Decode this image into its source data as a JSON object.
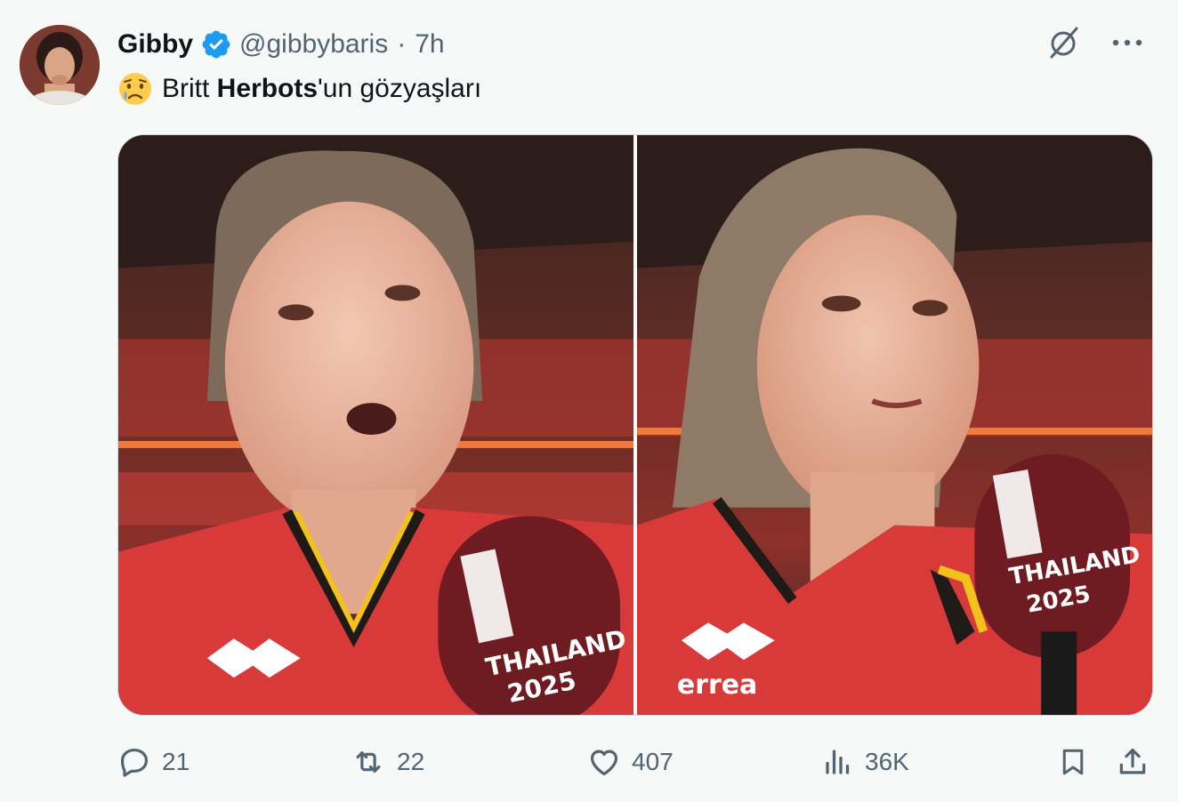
{
  "author": {
    "display_name": "Gibby",
    "handle": "@gibbybaris",
    "separator": "·",
    "time": "7h",
    "verified": true,
    "avatar_icon": "profile-photo"
  },
  "post": {
    "emoji_icon": "crying-face-emoji",
    "text_before": "Britt ",
    "text_bold": "Herbots",
    "text_after": "'un gözyaşları"
  },
  "media": {
    "images": [
      {
        "label": "player interview photo 1",
        "mic_text_line1": "THAILAND",
        "mic_text_line2": "2025",
        "jersey_brand": "errea"
      },
      {
        "label": "player interview photo 2",
        "mic_text_line1": "THAILAND",
        "mic_text_line2": "2025",
        "jersey_brand": "errea"
      }
    ]
  },
  "actions": {
    "reply_count": "21",
    "repost_count": "22",
    "like_count": "407",
    "views_count": "36K"
  },
  "colors": {
    "background": "#f7f9f9",
    "text_primary": "#0f1419",
    "text_secondary": "#536471",
    "verified_blue": "#1d9bf0"
  }
}
